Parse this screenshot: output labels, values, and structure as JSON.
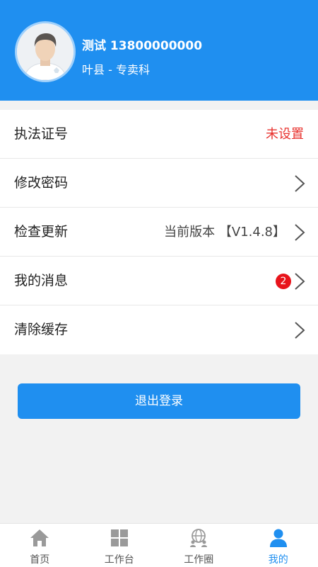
{
  "header": {
    "user_name": "测试  13800000000",
    "user_org": "叶县 - 专卖科"
  },
  "menu": {
    "items": [
      {
        "label": "执法证号",
        "value": "未设置"
      },
      {
        "label": "修改密码"
      },
      {
        "label": "检查更新",
        "value": "当前版本 【V1.4.8】"
      },
      {
        "label": "我的消息",
        "badge": "2"
      },
      {
        "label": "清除缓存"
      }
    ]
  },
  "logout_label": "退出登录",
  "bottom_nav": {
    "items": [
      {
        "label": "首页",
        "icon": "home-icon"
      },
      {
        "label": "工作台",
        "icon": "grid-icon"
      },
      {
        "label": "工作圈",
        "icon": "globe-people-icon"
      },
      {
        "label": "我的",
        "icon": "person-icon"
      }
    ],
    "active_index": 3
  },
  "colors": {
    "brand_blue": "#1f8ff0",
    "alert_red": "#e8322e",
    "badge_red": "#e8141b",
    "nav_gray": "#9a9a9a"
  }
}
